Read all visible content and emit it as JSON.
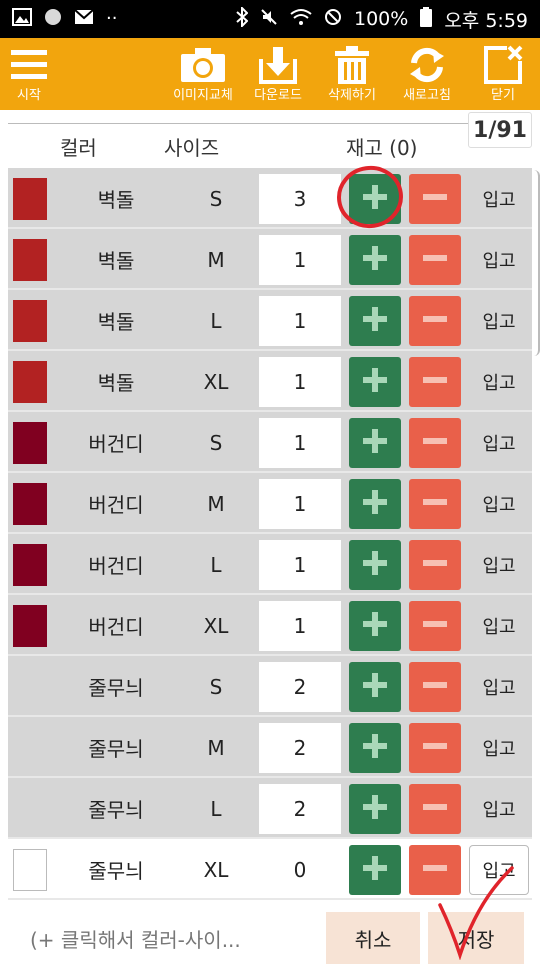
{
  "status_bar": {
    "battery": "100%",
    "time": "오후 5:59"
  },
  "toolbar": {
    "start_label": "시작",
    "image_replace_label": "이미지교체",
    "download_label": "다운로드",
    "delete_label": "삭제하기",
    "refresh_label": "새로고침",
    "close_label": "닫기",
    "color": "#f2a50d"
  },
  "header": {
    "color_label": "컬러",
    "size_label": "사이즈",
    "stock_label": "재고 (0)",
    "page_indicator": "1/91"
  },
  "rows": [
    {
      "color": "#b22222",
      "name": "벽돌",
      "size": "S",
      "qty": "3",
      "in_label": "입고"
    },
    {
      "color": "#b22222",
      "name": "벽돌",
      "size": "M",
      "qty": "1",
      "in_label": "입고"
    },
    {
      "color": "#b22222",
      "name": "벽돌",
      "size": "L",
      "qty": "1",
      "in_label": "입고"
    },
    {
      "color": "#b22222",
      "name": "벽돌",
      "size": "XL",
      "qty": "1",
      "in_label": "입고"
    },
    {
      "color": "#800020",
      "name": "버건디",
      "size": "S",
      "qty": "1",
      "in_label": "입고"
    },
    {
      "color": "#800020",
      "name": "버건디",
      "size": "M",
      "qty": "1",
      "in_label": "입고"
    },
    {
      "color": "#800020",
      "name": "버건디",
      "size": "L",
      "qty": "1",
      "in_label": "입고"
    },
    {
      "color": "#800020",
      "name": "버건디",
      "size": "XL",
      "qty": "1",
      "in_label": "입고"
    },
    {
      "color": "",
      "name": "줄무늬",
      "size": "S",
      "qty": "2",
      "in_label": "입고"
    },
    {
      "color": "",
      "name": "줄무늬",
      "size": "M",
      "qty": "2",
      "in_label": "입고"
    },
    {
      "color": "",
      "name": "줄무늬",
      "size": "L",
      "qty": "2",
      "in_label": "입고"
    },
    {
      "color": "#ffffff",
      "name": "줄무늬",
      "size": "XL",
      "qty": "0",
      "in_label": "입고"
    }
  ],
  "footer": {
    "add_hint": "(+ 클릭해서 컬러-사이...",
    "cancel_label": "취소",
    "save_label": "저장"
  },
  "accent_colors": {
    "plus": "#2e7d4f",
    "minus": "#e9604a",
    "annotation": "#e0242b"
  }
}
